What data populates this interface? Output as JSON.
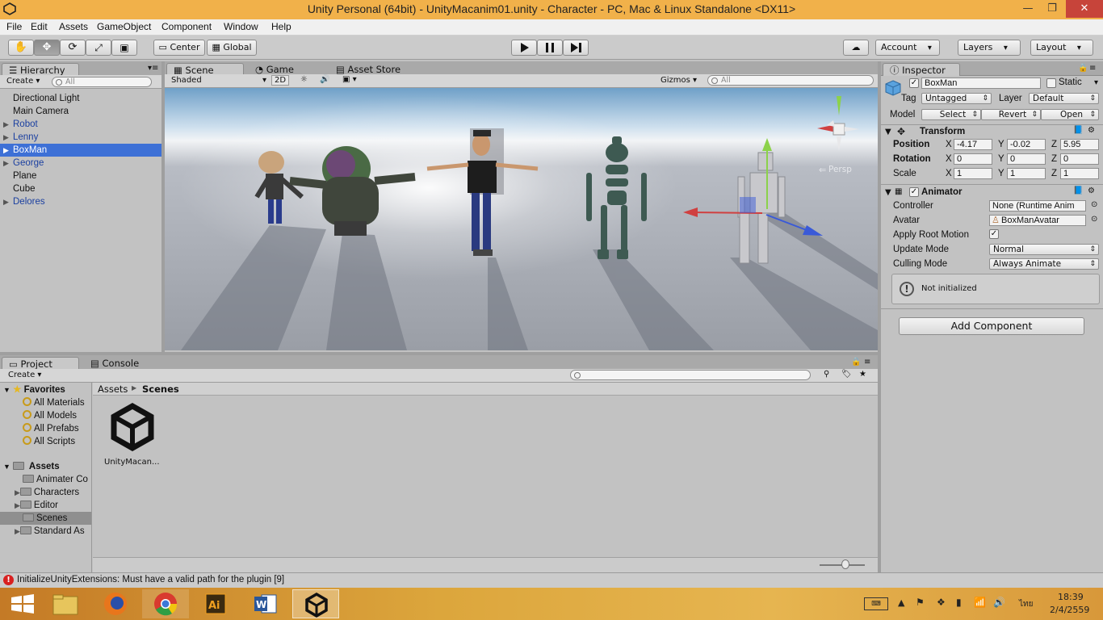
{
  "window": {
    "title": "Unity Personal (64bit) - UnityMacanim01.unity - Character - PC, Mac & Linux Standalone <DX11>"
  },
  "menu": [
    "File",
    "Edit",
    "Assets",
    "GameObject",
    "Component",
    "Window",
    "Help"
  ],
  "toolbar": {
    "pivot": "Center",
    "space": "Global",
    "account": "Account",
    "layers": "Layers",
    "layout": "Layout"
  },
  "hierarchy": {
    "tab": "Hierarchy",
    "create": "Create",
    "search_placeholder": "All",
    "items": [
      {
        "label": "Directional Light"
      },
      {
        "label": "Main Camera"
      },
      {
        "label": "Robot"
      },
      {
        "label": "Lenny"
      },
      {
        "label": "BoxMan"
      },
      {
        "label": "George"
      },
      {
        "label": "Plane"
      },
      {
        "label": "Cube"
      },
      {
        "label": "Delores"
      }
    ]
  },
  "scene": {
    "tabs": {
      "scene": "Scene",
      "game": "Game",
      "store": "Asset Store"
    },
    "shading": "Shaded",
    "mode2d": "2D",
    "gizmos": "Gizmos",
    "search_placeholder": "All",
    "persp": "Persp"
  },
  "inspector": {
    "tab": "Inspector",
    "object_name": "BoxMan",
    "static": "Static",
    "tag_label": "Tag",
    "tag_value": "Untagged",
    "layer_label": "Layer",
    "layer_value": "Default",
    "model_label": "Model",
    "model_buttons": {
      "select": "Select",
      "revert": "Revert",
      "open": "Open"
    },
    "transform": {
      "title": "Transform",
      "position_label": "Position",
      "rotation_label": "Rotation",
      "scale_label": "Scale",
      "axes": {
        "x": "X",
        "y": "Y",
        "z": "Z"
      },
      "position": {
        "x": "-4.17",
        "y": "-0.02",
        "z": "5.95"
      },
      "rotation": {
        "x": "0",
        "y": "0",
        "z": "0"
      },
      "scale": {
        "x": "1",
        "y": "1",
        "z": "1"
      }
    },
    "animator": {
      "title": "Animator",
      "controller_label": "Controller",
      "controller_value": "None (Runtime Anim",
      "avatar_label": "Avatar",
      "avatar_value": "BoxManAvatar",
      "root_motion_label": "Apply Root Motion",
      "update_mode_label": "Update Mode",
      "update_mode_value": "Normal",
      "culling_mode_label": "Culling Mode",
      "culling_mode_value": "Always Animate",
      "notice": "Not initialized"
    },
    "add_component": "Add Component"
  },
  "project": {
    "tabs": {
      "project": "Project",
      "console": "Console"
    },
    "create": "Create",
    "favorites_label": "Favorites",
    "favorites": [
      "All Materials",
      "All Models",
      "All Prefabs",
      "All Scripts"
    ],
    "assets_label": "Assets",
    "folders": [
      "Animater Co",
      "Characters",
      "Editor",
      "Scenes",
      "Standard As"
    ],
    "breadcrumb": {
      "root": "Assets",
      "current": "Scenes"
    },
    "files": [
      {
        "name": "UnityMacan..."
      }
    ]
  },
  "status": {
    "message": "InitializeUnityExtensions: Must have a valid path for the plugin [9]"
  },
  "taskbar": {
    "lang": "ไทย",
    "time": "18:39",
    "date": "2/4/2559"
  }
}
